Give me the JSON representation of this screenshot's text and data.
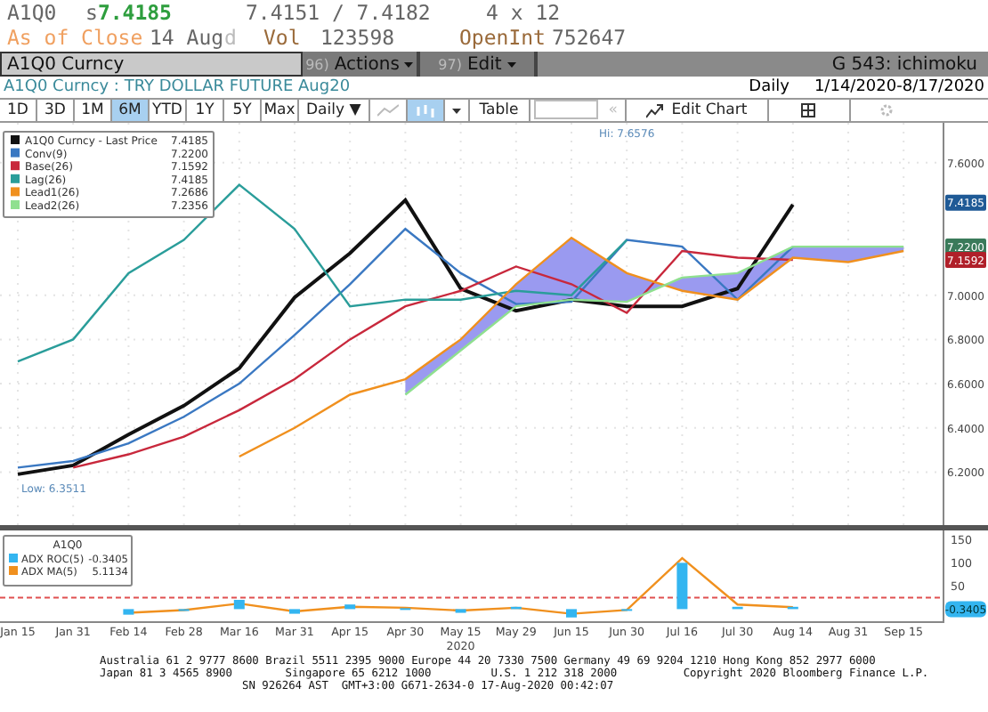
{
  "quote": {
    "ticker": "A1Q0",
    "source": "s",
    "last": "7.4185",
    "bid_ask": "7.4151 / 7.4182",
    "size": "4 x 12"
  },
  "close_row": {
    "label": "As of Close",
    "date": "14 Aug",
    "flag": "d",
    "vol_label": "Vol",
    "vol": "123598",
    "oi_label": "OpenInt",
    "oi": "752647"
  },
  "command_bar": {
    "security": "A1Q0 Curncy",
    "menus": [
      {
        "number": "96)",
        "label": "Actions"
      },
      {
        "number": "97)",
        "label": "Edit"
      }
    ],
    "page": "G 543: ichimoku"
  },
  "title_row": {
    "title": "A1Q0 Curncy : TRY DOLLAR FUTURE Aug20",
    "frequency": "Daily",
    "range": "1/14/2020-8/17/2020"
  },
  "toolbar": {
    "periods": [
      {
        "label": "1D",
        "selected": false
      },
      {
        "label": "3D",
        "selected": false
      },
      {
        "label": "1M",
        "selected": false
      },
      {
        "label": "6M",
        "selected": true
      },
      {
        "label": "YTD",
        "selected": false
      },
      {
        "label": "1Y",
        "selected": false
      },
      {
        "label": "5Y",
        "selected": false
      },
      {
        "label": "Max",
        "selected": false
      }
    ],
    "frequency": {
      "value": "Daily",
      "arrow": "▼"
    },
    "chart_types": [
      {
        "kind": "line",
        "selected": false
      },
      {
        "kind": "bar",
        "selected": true
      }
    ],
    "table": "Table",
    "back": "«",
    "edit_chart": "Edit Chart"
  },
  "main_chart": {
    "legend_values": [
      "7.4185",
      "7.2200",
      "7.1592",
      "7.4185",
      "7.2686",
      "7.2356"
    ],
    "price_tags": [
      {
        "text": "7.4185",
        "color": "#1f5a96"
      },
      {
        "text": "7.2200",
        "color": "#3a7a5a"
      },
      {
        "text": "7.1592",
        "color": "#b0202a"
      }
    ],
    "hi_label": "Hi: 7.6576",
    "low_label": "Low: 6.3511",
    "year_label": "2020",
    "chart_data": {
      "type": "line",
      "grid": true,
      "legend": "upper left",
      "ylim": [
        5.96,
        7.78
      ],
      "yticks": [
        {
          "value": 6.2,
          "label": "6.2000"
        },
        {
          "value": 6.4,
          "label": "6.4000"
        },
        {
          "value": 6.6,
          "label": "6.6000"
        },
        {
          "value": 6.8,
          "label": "6.8000"
        },
        {
          "value": 7.0,
          "label": "7.0000"
        },
        {
          "value": 7.6,
          "label": "7.6000"
        }
      ],
      "series": [
        {
          "name": "A1Q0 Curncy - Last Price",
          "color": "#111111",
          "values": [
            6.19,
            6.23,
            6.37,
            6.5,
            6.67,
            6.99,
            7.19,
            7.43,
            7.03,
            6.93,
            6.98,
            6.95,
            6.95,
            7.03,
            7.41,
            null,
            null
          ]
        },
        {
          "name": "Conv(9)",
          "color": "#3a78c2",
          "values": [
            6.22,
            6.25,
            6.33,
            6.45,
            6.6,
            6.82,
            7.05,
            7.3,
            7.1,
            6.96,
            6.97,
            7.25,
            7.22,
            6.98,
            7.22,
            null,
            null
          ]
        },
        {
          "name": "Base(26)",
          "color": "#c8283c",
          "values": [
            null,
            6.22,
            6.28,
            6.36,
            6.48,
            6.62,
            6.8,
            6.95,
            7.02,
            7.13,
            7.05,
            6.92,
            7.2,
            7.17,
            7.16,
            null,
            null
          ]
        },
        {
          "name": "Lag(26)",
          "color": "#2a9d9a",
          "values": [
            6.7,
            6.8,
            7.1,
            7.25,
            7.5,
            7.3,
            6.95,
            6.98,
            6.98,
            7.02,
            7.0,
            7.25,
            null,
            null,
            null,
            null,
            null
          ]
        },
        {
          "name": "Lead1(26)",
          "color": "#f0901e",
          "values": [
            null,
            null,
            null,
            null,
            6.27,
            6.4,
            6.55,
            6.62,
            6.8,
            7.05,
            7.26,
            7.1,
            7.02,
            6.98,
            7.17,
            7.15,
            7.2
          ]
        },
        {
          "name": "Lead2(26)",
          "color": "#8fe08f",
          "values": [
            null,
            null,
            null,
            null,
            null,
            null,
            null,
            6.55,
            6.75,
            6.95,
            6.98,
            6.97,
            7.08,
            7.1,
            7.22,
            7.22,
            7.22
          ]
        }
      ]
    }
  },
  "study_chart": {
    "title": "A1Q0",
    "legend_values": [
      "-0.3405",
      "5.1134"
    ],
    "axis_tag": "-0.3405",
    "chart_data": {
      "type": "bar",
      "legend": "upper left",
      "x": [
        "Jan 15",
        "Jan 31",
        "Feb 14",
        "Feb 28",
        "Mar 16",
        "Mar 31",
        "Apr 15",
        "Apr 30",
        "May 15",
        "May 29",
        "Jun 15",
        "Jun 30",
        "Jul 16",
        "Jul 30",
        "Aug 14",
        "Aug 31",
        "Sep 15"
      ],
      "ylim": [
        -30,
        170
      ],
      "yticks": [
        50,
        100,
        150
      ],
      "ref_lines": [
        {
          "axis": "y",
          "value": 25
        }
      ],
      "series": [
        {
          "name": "ADX ROC(5)",
          "color": "#33b5f0",
          "values": [
            null,
            null,
            -12,
            -4,
            20,
            -10,
            10,
            2,
            -8,
            5,
            -18,
            0,
            100,
            5,
            5,
            null,
            null
          ]
        },
        {
          "name": "ADX MA(5)",
          "color": "#f0901e",
          "type": "line",
          "values": [
            null,
            null,
            -8,
            -2,
            12,
            -5,
            5,
            3,
            -3,
            3,
            -10,
            -2,
            110,
            10,
            4,
            null,
            null
          ]
        }
      ]
    }
  },
  "footer": [
    "Australia 61 2 9777 8600 Brazil 5511 2395 9000 Europe 44 20 7330 7500 Germany 49 69 9204 1210 Hong Kong 852 2977 6000",
    "Japan 81 3 4565 8900        Singapore 65 6212 1000         U.S. 1 212 318 2000          Copyright 2020 Bloomberg Finance L.P.",
    "SN 926264 AST  GMT+3:00 G671-2634-0 17-Aug-2020 00:42:07"
  ]
}
